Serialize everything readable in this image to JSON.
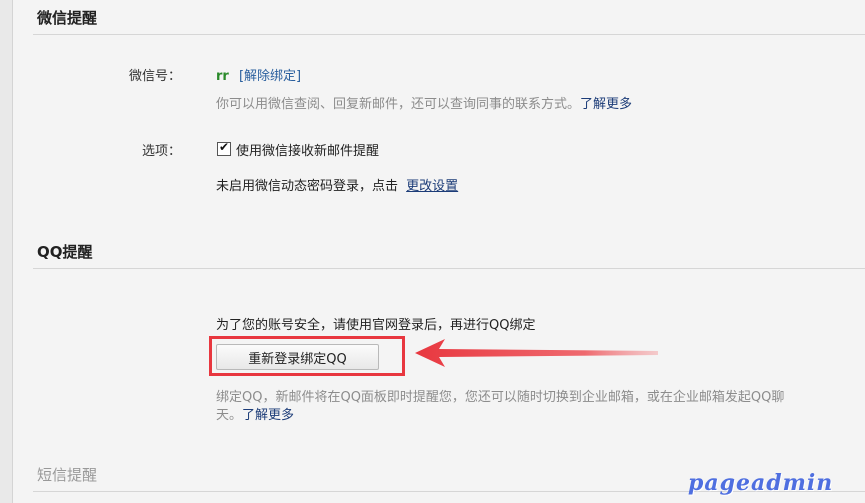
{
  "wechat": {
    "title": "微信提醒",
    "id_label": "微信号：",
    "id_value": "rr",
    "unbind_link": "[解除绑定]",
    "desc": "你可以用微信查阅、回复新邮件，还可以查询同事的联系方式。",
    "learn_more": "了解更多",
    "options_label": "选项：",
    "option_checked": true,
    "option_text": "使用微信接收新邮件提醒",
    "dynamic_pw_text": "未启用微信动态密码登录，点击",
    "change_settings": "更改设置"
  },
  "qq": {
    "title": "QQ提醒",
    "security_text": "为了您的账号安全，请使用官网登录后，再进行QQ绑定",
    "rebind_button": "重新登录绑定QQ",
    "desc_line1": "绑定QQ，新邮件将在QQ面板即时提醒您，您还可以随时切换到企业邮箱，或在企业邮箱发起QQ聊",
    "desc_line2": "天。",
    "learn_more": "了解更多"
  },
  "sms": {
    "title": "短信提醒"
  },
  "watermark": "pageadmin",
  "colors": {
    "annotation_red": "#e8373f",
    "link_blue": "#1c3c78",
    "wechat_green": "#2a8a2a"
  }
}
